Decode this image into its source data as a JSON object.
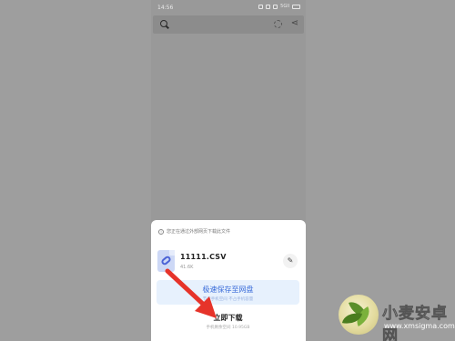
{
  "status_bar": {
    "time": "14:56",
    "network_label": "5Gll"
  },
  "sheet": {
    "notice": "您正在通过外部网页下载此文件",
    "file": {
      "name": "11111.CSV",
      "size": "41.6K"
    },
    "save_cloud": {
      "label": "极速保存至网盘",
      "sublabel": "节省手机空间 不占手机容量"
    },
    "download": {
      "label": "立即下载",
      "sublabel": "手机剩余空间 10.95GB"
    }
  },
  "watermark": {
    "title": "小麦安卓网",
    "url": "www.xmsigma.com"
  },
  "colors": {
    "accent_blue": "#3a6cd9",
    "arrow_red": "#e6332a",
    "overlay": "#999999"
  }
}
